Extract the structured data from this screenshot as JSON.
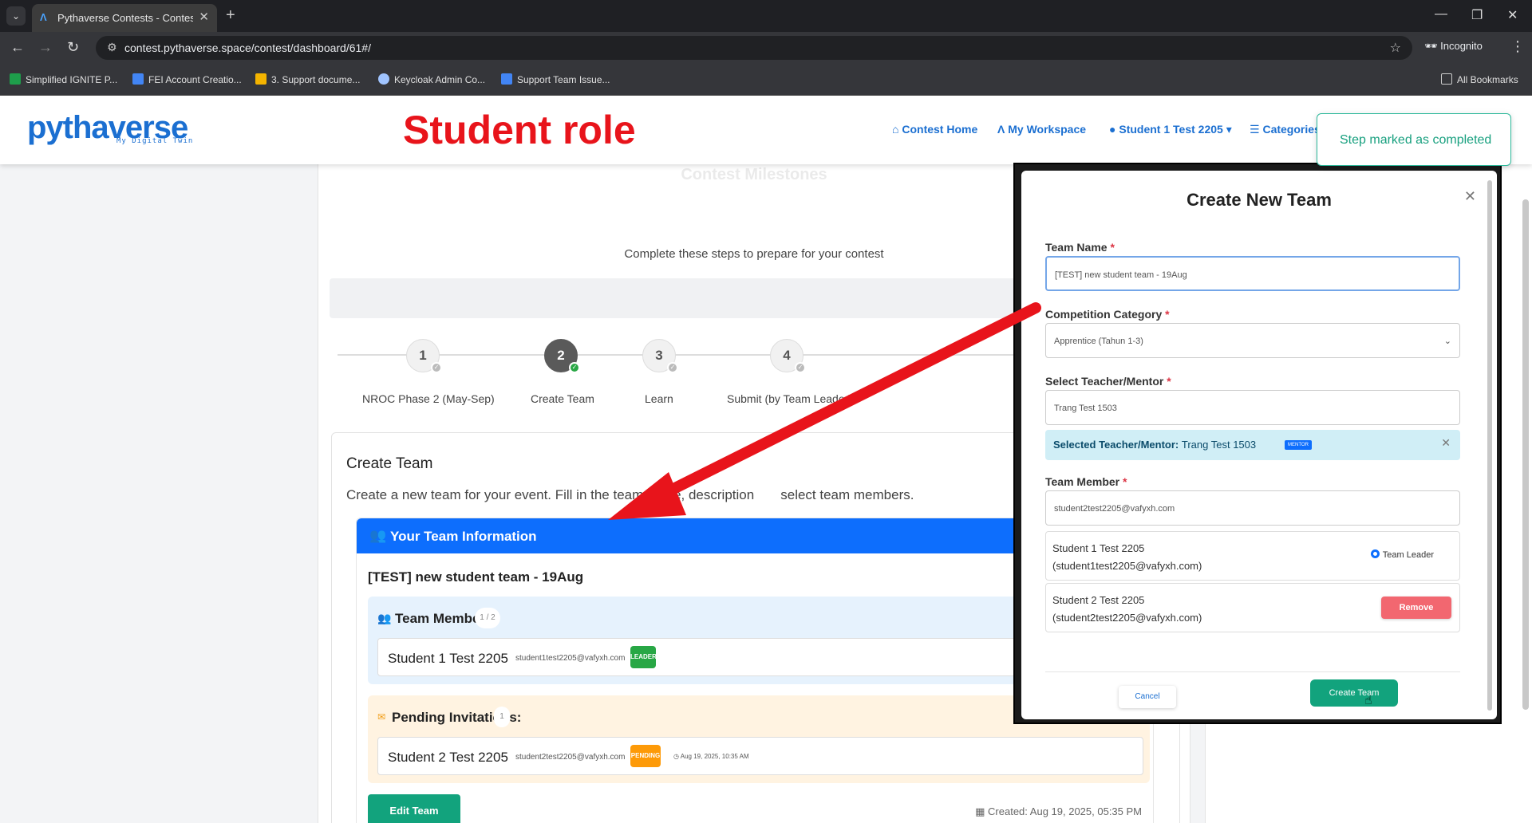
{
  "browser": {
    "tab_title": "Pythaverse Contests - Contest D",
    "url": "contest.pythaverse.space/contest/dashboard/61#/",
    "incognito_label": "Incognito",
    "bookmarks": [
      {
        "label": "Simplified IGNITE P...",
        "color": "#1e9e4b"
      },
      {
        "label": "FEI Account Creatio...",
        "color": "#4285f4"
      },
      {
        "label": "3. Support docume...",
        "color": "#f4b400"
      },
      {
        "label": "Keycloak Admin Co...",
        "color": "#a0c4ff"
      },
      {
        "label": "Support Team Issue...",
        "color": "#4285f4"
      }
    ],
    "all_bookmarks": "All Bookmarks"
  },
  "header": {
    "logo": "pythaverse",
    "logo_sub": "My Digital Twin",
    "annotation": "Student role",
    "nav": {
      "home": "Contest Home",
      "workspace": "My Workspace",
      "user": "Student 1 Test 2205",
      "categories": "Categories"
    },
    "toast": "Step marked as completed"
  },
  "milestones": {
    "title": "Contest Milestones",
    "subtitle": "Complete these steps to prepare for your contest",
    "steps": [
      {
        "num": "1",
        "label": "NROC Phase 2 (May-Sep)"
      },
      {
        "num": "2",
        "label": "Create Team"
      },
      {
        "num": "3",
        "label": "Learn"
      },
      {
        "num": "4",
        "label": "Submit (by Team Leader)"
      }
    ]
  },
  "create_team": {
    "title": "Create Team",
    "description": "Create a new team for your event. Fill in the team name, description",
    "description_tail": "select team members.",
    "info_header": "Your Team Information",
    "team_name": "[TEST] new student team - 19Aug",
    "members_title": "Team Members:",
    "members_count": "1 / 2",
    "member": {
      "name": "Student 1 Test 2205",
      "email": "student1test2205@vafyxh.com",
      "badge": "LEADER"
    },
    "pending_title": "Pending Invitations:",
    "pending_count": "1",
    "pending": {
      "name": "Student 2 Test 2205",
      "email": "student2test2205@vafyxh.com",
      "badge": "PENDING",
      "date": "Aug 19, 2025, 10:35 AM"
    },
    "edit_button": "Edit Team",
    "created": "Created: Aug 19, 2025, 05:35 PM"
  },
  "modal": {
    "title": "Create New Team",
    "team_name_label": "Team Name",
    "team_name_value": "[TEST] new student team - 19Aug",
    "category_label": "Competition Category",
    "category_value": "Apprentice (Tahun 1-3)",
    "mentor_label": "Select Teacher/Mentor",
    "mentor_input": "Trang Test 1503",
    "selected_mentor_label": "Selected Teacher/Mentor:",
    "selected_mentor_value": "Trang Test 1503",
    "mentor_tag": "MENTOR",
    "member_label": "Team Member",
    "member_input": "student2test2205@vafyxh.com",
    "members": [
      {
        "name": "Student 1 Test 2205",
        "email": "(student1test2205@vafyxh.com)"
      },
      {
        "name": "Student 2 Test 2205",
        "email": "(student2test2205@vafyxh.com)"
      }
    ],
    "team_leader_label": "Team Leader",
    "remove_label": "Remove",
    "cancel_label": "Cancel",
    "create_label": "Create Team",
    "required_mark": "*"
  },
  "colors": {
    "arrow": "#e8141b",
    "primary": "#0d6efd",
    "success": "#12a37d"
  }
}
